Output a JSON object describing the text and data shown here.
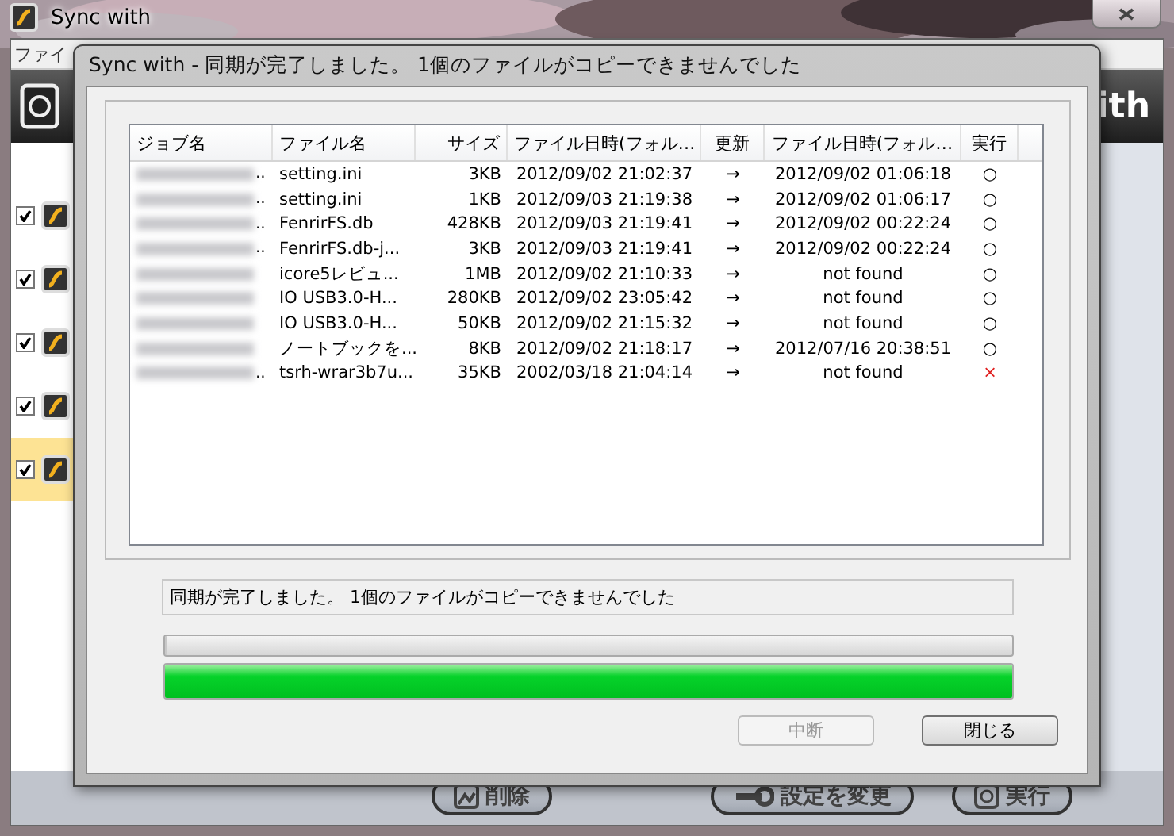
{
  "main_window": {
    "title": "Sync with",
    "menu": [
      "ファイ"
    ],
    "logo_text": "ith",
    "jobs": [
      {
        "checked": true,
        "selected": false
      },
      {
        "checked": true,
        "selected": false
      },
      {
        "checked": true,
        "selected": false
      },
      {
        "checked": true,
        "selected": false
      },
      {
        "checked": true,
        "selected": true
      }
    ],
    "buttons": [
      {
        "label": "削除",
        "kind": "delete"
      },
      {
        "label": "設定を変更",
        "kind": "settings"
      },
      {
        "label": "実行",
        "kind": "run"
      }
    ]
  },
  "dialog": {
    "title": "Sync with - 同期が完了しました。 1個のファイルがコピーできませんでした",
    "columns": [
      "ジョブ名",
      "ファイル名",
      "サイズ",
      "ファイル日時(フォル…",
      "更新",
      "ファイル日時(フォル…",
      "実行"
    ],
    "rows": [
      {
        "job_tail": "..",
        "file": "setting.ini",
        "size": "3KB",
        "src_time": "2012/09/02 21:02:37",
        "update": "→",
        "dst_time": "2012/09/02 01:06:18",
        "result": "○",
        "failed": false
      },
      {
        "job_tail": "..",
        "file": "setting.ini",
        "size": "1KB",
        "src_time": "2012/09/03 21:19:38",
        "update": "→",
        "dst_time": "2012/09/02 01:06:17",
        "result": "○",
        "failed": false
      },
      {
        "job_tail": "..",
        "file": "FenrirFS.db",
        "size": "428KB",
        "src_time": "2012/09/03 21:19:41",
        "update": "→",
        "dst_time": "2012/09/02 00:22:24",
        "result": "○",
        "failed": false
      },
      {
        "job_tail": "..",
        "file": "FenrirFS.db-j...",
        "size": "3KB",
        "src_time": "2012/09/03 21:19:41",
        "update": "→",
        "dst_time": "2012/09/02 00:22:24",
        "result": "○",
        "failed": false
      },
      {
        "file": "icore5レビュ...",
        "size": "1MB",
        "src_time": "2012/09/02 21:10:33",
        "update": "→",
        "dst_time": "not found",
        "result": "○",
        "failed": false
      },
      {
        "file": "IO USB3.0-H...",
        "size": "280KB",
        "src_time": "2012/09/02 23:05:42",
        "update": "→",
        "dst_time": "not found",
        "result": "○",
        "failed": false
      },
      {
        "file": "IO USB3.0-H...",
        "size": "50KB",
        "src_time": "2012/09/02 21:15:32",
        "update": "→",
        "dst_time": "not found",
        "result": "○",
        "failed": false
      },
      {
        "file": "ノートブックを...",
        "size": "8KB",
        "src_time": "2012/09/02 21:18:17",
        "update": "→",
        "dst_time": "2012/07/16 20:38:51",
        "result": "○",
        "failed": false
      },
      {
        "job_tail": "..",
        "file": "tsrh-wrar3b7u...",
        "size": "35KB",
        "src_time": "2002/03/18 21:04:14",
        "update": "→",
        "dst_time": "not found",
        "result": "×",
        "failed": true
      }
    ],
    "status": "同期が完了しました。 1個のファイルがコピーできませんでした",
    "progress": [
      {
        "kind": "file",
        "level": 0
      },
      {
        "kind": "total",
        "level": 1
      }
    ],
    "buttons": [
      {
        "label": "中断",
        "disabled": true
      },
      {
        "label": "閉じる",
        "disabled": false
      }
    ]
  }
}
